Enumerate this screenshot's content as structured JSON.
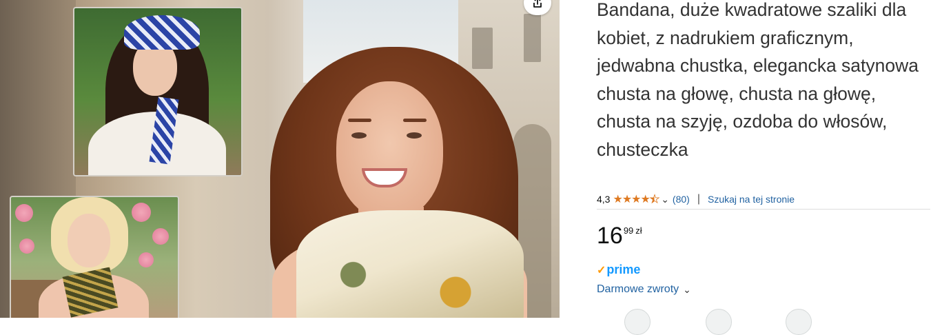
{
  "product": {
    "title": "Bandana, duże kwadratowe szaliki dla kobiet, z nadrukiem graficznym, jedwabna chustka, elegancka satynowa chusta na głowę, chusta na głowę, chusta na szyję, ozdoba do włosów, chusteczka",
    "rating": {
      "value": "4,3",
      "stars": 4.3,
      "count": "(80)",
      "search_link": "Szukaj na tej stronie"
    },
    "price": {
      "whole": "16",
      "fraction": "99",
      "currency": "zł"
    },
    "prime_label": "prime",
    "returns_label": "Darmowe zwroty"
  },
  "icons": {
    "share": "share-icon",
    "star": "star-icon",
    "chevron": "chevron-down-icon",
    "prime_check": "prime-check-icon"
  },
  "colors": {
    "title_text": "#333333",
    "link": "#2162a1",
    "star": "#de7921",
    "prime_blue": "#1399ff",
    "prime_orange": "#ff9900"
  }
}
